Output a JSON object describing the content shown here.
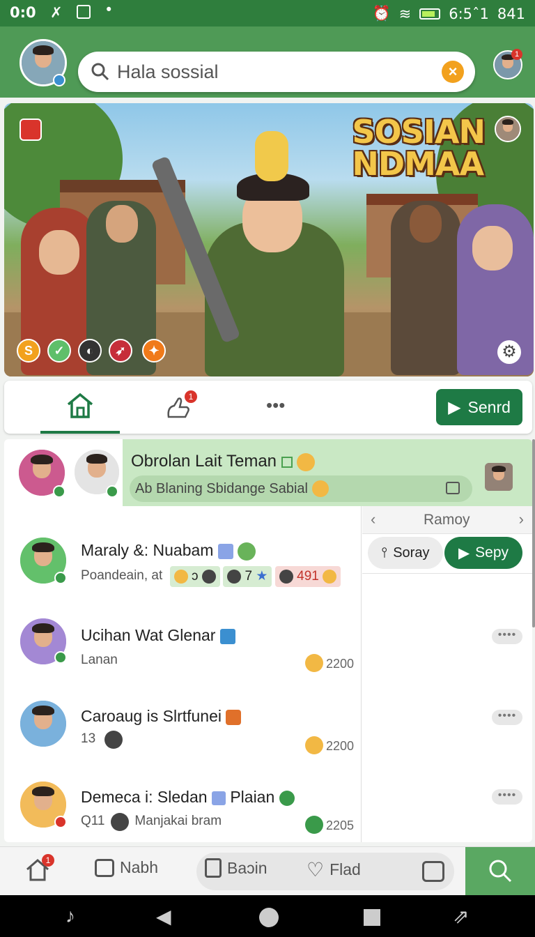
{
  "status": {
    "time": "0:0",
    "clock": "6:5ˆ1",
    "battery": "841"
  },
  "search": {
    "value": "Hala sossial",
    "clear": "×"
  },
  "banner": {
    "title_line1": "SOSIAN",
    "title_line2": "NDMAA",
    "chip_1": "S"
  },
  "tabs": {
    "notif_count": "1",
    "more": "•••",
    "send_label": "Senrd"
  },
  "pinned": {
    "title": "Obrolan Lait Teman",
    "input_placeholder": "Ab Blaning Sbidange Sabial"
  },
  "side": {
    "title": "Ramoy",
    "btn1": "Soray",
    "btn2": "Sepy"
  },
  "chats": [
    {
      "title": "Maraly &:  Nuabam",
      "sub": "Poandeain, at",
      "tag1": "ɔ",
      "tag2": "7",
      "tag3": "491"
    },
    {
      "title": "Ucihan Wat Glenar",
      "sub": "Lanan",
      "count": "2200"
    },
    {
      "title": "Caroaug is Slrtfunei",
      "sub": "13",
      "count": "2200"
    },
    {
      "title": "Demeca i: Sledan",
      "title2": "Plaian",
      "sub_prefix": "Q11",
      "sub": "Manjakai bram",
      "count": "2205"
    }
  ],
  "bottom": {
    "badge": "1",
    "item1": "Nabh",
    "item2": "Baɔin",
    "item3": "Flad"
  },
  "colors": {
    "brand": "#4f9a56",
    "dark_green": "#1e7a45",
    "accent": "#f2a11e"
  }
}
